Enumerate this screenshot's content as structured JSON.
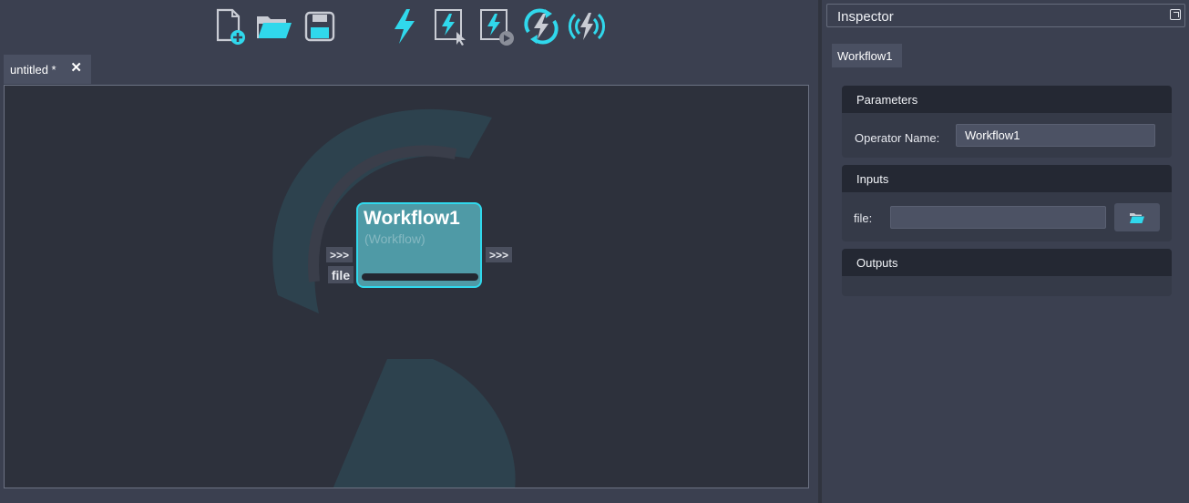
{
  "toolbar": {
    "buttons": [
      {
        "name": "new-file",
        "icon": "new-file-icon"
      },
      {
        "name": "open-folder",
        "icon": "open-folder-icon"
      },
      {
        "name": "save",
        "icon": "save-icon"
      },
      {
        "name": "run",
        "icon": "lightning-icon"
      },
      {
        "name": "run-selected",
        "icon": "lightning-cursor-icon"
      },
      {
        "name": "run-play",
        "icon": "lightning-play-icon"
      },
      {
        "name": "run-loop",
        "icon": "lightning-cycle-icon"
      },
      {
        "name": "run-broadcast",
        "icon": "lightning-signal-icon"
      }
    ]
  },
  "tab": {
    "label": "untitled *",
    "close": "✕"
  },
  "node": {
    "title": "Workflow1",
    "subtitle": "(Workflow)",
    "in_port": ">>>",
    "in_label": "file",
    "out_port": ">>>"
  },
  "inspector": {
    "title": "Inspector",
    "tab": "Workflow1",
    "parameters": {
      "heading": "Parameters",
      "operator_name_label": "Operator Name:",
      "operator_name_value": "Workflow1"
    },
    "inputs": {
      "heading": "Inputs",
      "file_label": "file:",
      "file_value": ""
    },
    "outputs": {
      "heading": "Outputs"
    }
  },
  "colors": {
    "accent": "#30d8ec",
    "background": "#3b4050",
    "canvas": "#2d313c",
    "node_fill": "#4f9aa6"
  }
}
